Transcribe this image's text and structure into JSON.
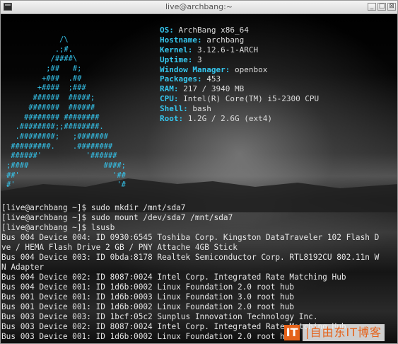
{
  "window": {
    "title": "live@archbang:~",
    "buttons": [
      "_",
      "□",
      "⊠"
    ]
  },
  "ascii_art": [
    "            /\\",
    "           .;#.",
    "          /####\\",
    "         ;##   #;",
    "        +###  .##",
    "       +####  ;###",
    "      ######  #####;",
    "     #######  ######",
    "    ######## ########",
    "  .########;;########.",
    "  .########;   ;#######",
    " #########.    .########",
    " ######'          '######",
    ";####                 ####;",
    "##'                     '##",
    "#'                       '#"
  ],
  "sysinfo": [
    {
      "key": "OS:",
      "value": "ArchBang x86_64"
    },
    {
      "key": "Hostname:",
      "value": "archbang"
    },
    {
      "key": "Kernel:",
      "value": "3.12.6-1-ARCH"
    },
    {
      "key": "Uptime:",
      "value": "3"
    },
    {
      "key": "Window Manager:",
      "value": "openbox"
    },
    {
      "key": "Packages:",
      "value": "453"
    },
    {
      "key": "RAM:",
      "value": "217 / 3940 MB"
    },
    {
      "key": "CPU:",
      "value": "Intel(R) Core(TM) i5-2300 CPU"
    },
    {
      "key": "Shell:",
      "value": "bash"
    },
    {
      "key": "Root:",
      "value": "1.2G / 2.6G (ext4)"
    }
  ],
  "console": [
    "[live@archbang ~]$ sudo mkdir /mnt/sda7",
    "[live@archbang ~]$ sudo mount /dev/sda7 /mnt/sda7",
    "[live@archbang ~]$ lsusb",
    "Bus 004 Device 004: ID 0930:6545 Toshiba Corp. Kingston DataTraveler 102 Flash D",
    "ve / HEMA Flash Drive 2 GB / PNY Attache 4GB Stick",
    "Bus 004 Device 003: ID 0bda:8178 Realtek Semiconductor Corp. RTL8192CU 802.11n W",
    "N Adapter",
    "Bus 004 Device 002: ID 8087:0024 Intel Corp. Integrated Rate Matching Hub",
    "Bus 004 Device 001: ID 1d6b:0002 Linux Foundation 2.0 root hub",
    "Bus 001 Device 001: ID 1d6b:0003 Linux Foundation 3.0 root hub",
    "Bus 001 Device 001: ID 1d6b:0002 Linux Foundation 2.0 root hub",
    "Bus 003 Device 003: ID 1bcf:05c2 Sunplus Innovation Technology Inc.",
    "Bus 003 Device 002: ID 8087:0024 Intel Corp. Integrated Rate Matching Hub",
    "Bus 003 Device 001: ID 1d6b:0002 Linux Foundation 2.0 root hub"
  ],
  "watermark": {
    "logo": "IT",
    "text": "|自由东IT博客"
  },
  "colors": {
    "accent": "#35c6ee",
    "terminal_text": "#e6e6e6",
    "watermark": "#e5621a"
  }
}
